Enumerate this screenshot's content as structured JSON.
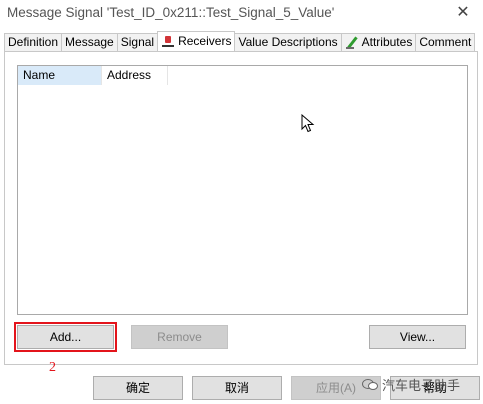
{
  "window": {
    "title": "Message Signal 'Test_ID_0x211::Test_Signal_5_Value'",
    "close_glyph": "✕"
  },
  "tabs": [
    {
      "label": "Definition",
      "icon": "",
      "active": false
    },
    {
      "label": "Message",
      "icon": "",
      "active": false
    },
    {
      "label": "Signal",
      "icon": "",
      "active": false
    },
    {
      "label": "Receivers",
      "icon": "receiver-node-icon",
      "active": true
    },
    {
      "label": "Value Descriptions",
      "icon": "",
      "active": false
    },
    {
      "label": "Attributes",
      "icon": "attributes-pen-icon",
      "active": false
    },
    {
      "label": "Comment",
      "icon": "",
      "active": false
    }
  ],
  "receivers_list": {
    "columns": [
      "Name",
      "Address"
    ],
    "rows": []
  },
  "panel_buttons": {
    "add": "Add...",
    "remove": "Remove",
    "view": "View..."
  },
  "annotation": {
    "step_number": "2",
    "color": "#e3141b"
  },
  "dialog_buttons": {
    "ok": "确定",
    "cancel": "取消",
    "apply": "应用(A)",
    "help": "帮助"
  },
  "watermark": {
    "text": "汽车电子助手",
    "icon": "wechat-icon"
  }
}
